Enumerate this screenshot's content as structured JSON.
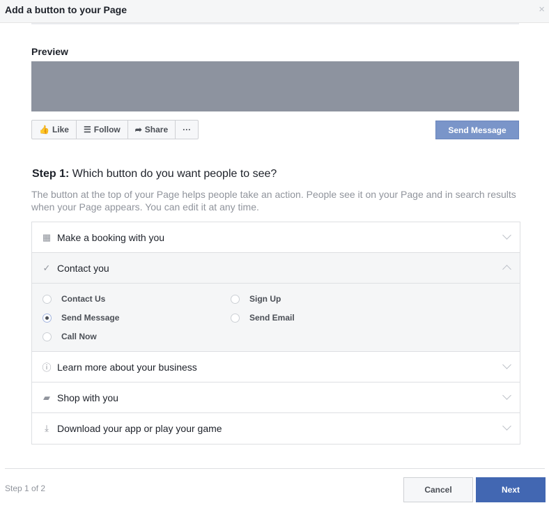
{
  "dialog": {
    "title": "Add a button to your Page",
    "close": "×"
  },
  "preview": {
    "label": "Preview",
    "actions": [
      {
        "label": "Like",
        "icon": "👍"
      },
      {
        "label": "Follow",
        "icon": "☰"
      },
      {
        "label": "Share",
        "icon": "➦"
      },
      {
        "label": "···"
      }
    ],
    "cta": "Send Message"
  },
  "step": {
    "prefix": "Step 1:",
    "question": " Which button do you want people to see?",
    "description": "The button at the top of your Page helps people take an action. People see it on your Page and in search results when your Page appears. You can edit it at any time."
  },
  "categories": [
    {
      "label": "Make a booking with you",
      "icon": "▦"
    },
    {
      "label": "Contact you",
      "icon": "✓",
      "expanded": true,
      "options": [
        {
          "label": "Contact Us"
        },
        {
          "label": "Send Message",
          "selected": true
        },
        {
          "label": "Call Now"
        },
        {
          "label": "Sign Up"
        },
        {
          "label": "Send Email"
        }
      ]
    },
    {
      "label": "Learn more about your business",
      "icon": "ⓘ"
    },
    {
      "label": "Shop with you",
      "icon": "▰"
    },
    {
      "label": "Download your app or play your game",
      "icon": "⤓"
    }
  ],
  "footer": {
    "step_count": "Step 1 of 2",
    "cancel": "Cancel",
    "next": "Next"
  }
}
